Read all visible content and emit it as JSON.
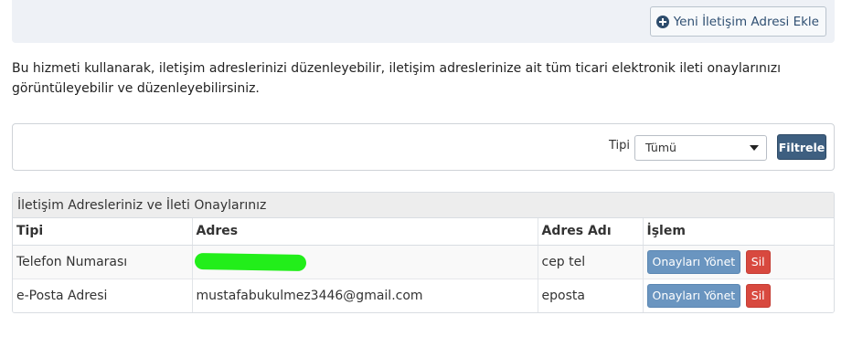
{
  "header": {
    "new_button_label": "Yeni İletişim Adresi Ekle",
    "new_button_icon": "plus-circle-icon"
  },
  "intro_text": "Bu hizmeti kullanarak, iletişim adreslerinizi düzenleyebilir, iletişim adreslerinize ait tüm ticari elektronik ileti onaylarınızı görüntüleyebilir ve düzenleyebilirsiniz.",
  "filter": {
    "type_label": "Tipi",
    "type_selected": "Tümü",
    "submit_label": "Filtrele"
  },
  "table": {
    "title": "İletişim Adresleriniz ve İleti Onaylarınız",
    "columns": [
      "Tipi",
      "Adres",
      "Adres Adı",
      "İşlem"
    ],
    "rows": [
      {
        "type": "Telefon Numarası",
        "address": "",
        "address_redacted": true,
        "name": "cep tel",
        "manage_label": "Onayları Yönet",
        "delete_label": "Sil"
      },
      {
        "type": "e-Posta Adresi",
        "address": "mustafabukulmez3446@gmail.com",
        "address_redacted": false,
        "name": "eposta",
        "manage_label": "Onayları Yönet",
        "delete_label": "Sil"
      }
    ]
  },
  "colors": {
    "primary_button": "#3e5f80",
    "info_button": "#6a95c0",
    "danger_button": "#d8493f",
    "redaction_mark": "#22ee1a"
  }
}
